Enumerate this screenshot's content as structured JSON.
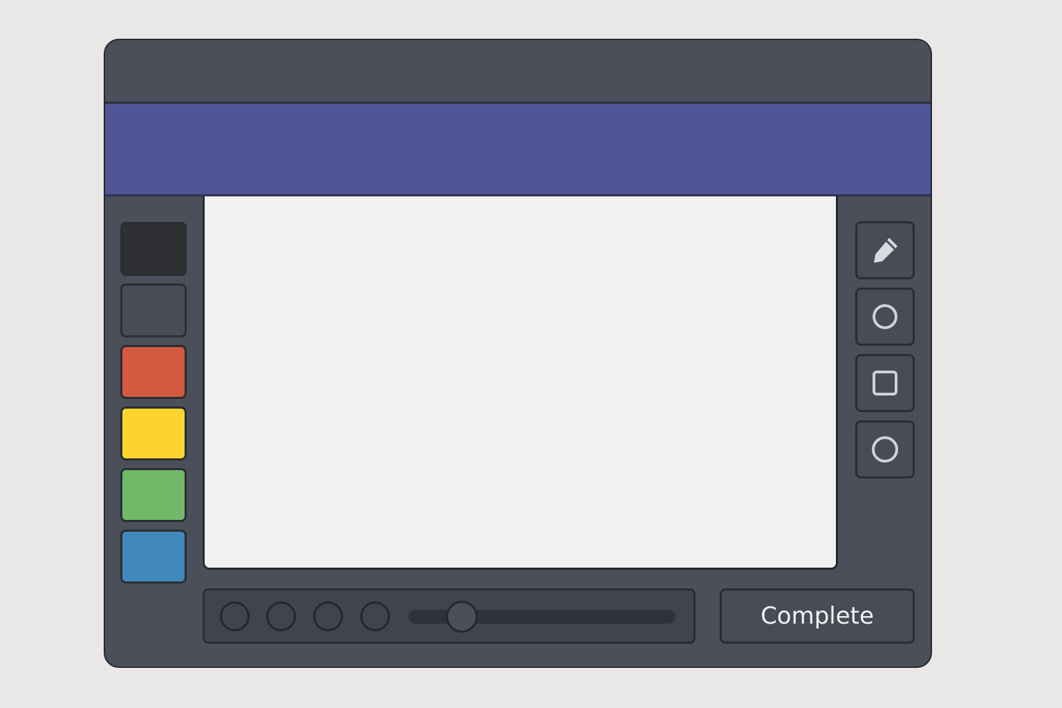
{
  "palette": {
    "swatches": [
      {
        "name": "black",
        "color": "#2e3034"
      },
      {
        "name": "dark-gray",
        "color": "#474c56"
      },
      {
        "name": "red",
        "color": "#d45a3f"
      },
      {
        "name": "yellow",
        "color": "#fdd42d"
      },
      {
        "name": "green",
        "color": "#71b868"
      },
      {
        "name": "blue",
        "color": "#4189bb"
      }
    ]
  },
  "tools": [
    {
      "icon": "pencil-icon"
    },
    {
      "icon": "circle-icon"
    },
    {
      "icon": "square-icon"
    },
    {
      "icon": "circle-icon"
    }
  ],
  "bottom_bar": {
    "brush_presets": [
      "preset-1",
      "preset-2",
      "preset-3",
      "preset-4"
    ],
    "slider_value": 0.2
  },
  "actions": {
    "complete_label": "Complete"
  },
  "colors": {
    "window": "#4a4f59",
    "banner": "#505695",
    "canvas": "#f1f1f1"
  }
}
